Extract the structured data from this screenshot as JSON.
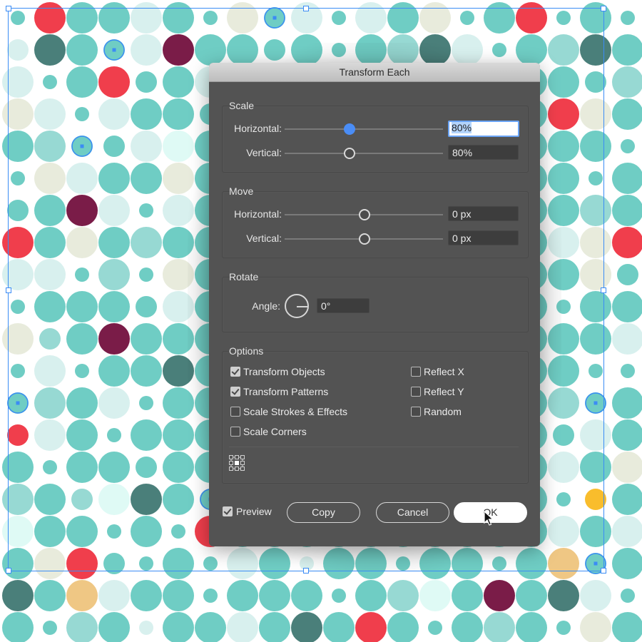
{
  "app": {
    "canvas_description": "polka-dot pattern artboard with selected objects"
  },
  "palette": {
    "T": "#6fcdc4",
    "L": "#d8f0ee",
    "B": "#e8ebdc",
    "R": "#f03e4c",
    "D": "#4a7f7a",
    "M": "#7a1c48",
    "P": "#97d9d3",
    "C": "#dffaf5",
    "Y": "#f9bd2c",
    "O": "#efc784",
    "selection": "#3b8cf5"
  },
  "pattern": {
    "rows": [
      "Ts Rl Tl Tl Ll Tl Ts Bl Tm* Ll Ts Ll Tl Bl Ts Tl Rl Ts Tl Ts",
      "Lm Dl Tl Tm* Ll Ml Tl Tl Tm Tl Ts Tl Pl Dl Ll Ts Tl Pl Dl Tl",
      "Ll Ts Tl Rl Tm Tl Ll Tl Tm Tl Ts Tl Tl Tl Tm Ll Tl Tl Tm Pl",
      "Bl Ll Ts Ll Tl Tl Tm Tl Tl Tl Tl Tl Tl Tl Tl Tl Tl Rl Bl Tl",
      "Tl Pl Tm* Tm Ll Cl Tl Tl Tl Tl Tl Tl Tl Tl Tl Tl Tl Tl Tl Ts",
      "Ts Bl Ll Tl Tl Bl Tl Tl Tl Tl Tl Tl Tl Tl Tl Tl Tl Tl Ts Tl",
      "Tm Tl Ml Ll Ts Ll Tl Tl Tl Tl Tl Tl Tl Tl Tl Tl Tl Tl Pl Tl",
      "Rl Tl Bl Tl Pl Tl Tl Tl Tl Tl Tl Tl Tl Tl Tl Tl Tl Ll Bl Rl",
      "Ll Ll Ts Pl Ts Bl Tl Tl Tl Tl Tl Tl Tl Tl Tl Tl Tl Tl Bl Tm",
      "Ts Tl Tl Tl Tm Ll Tl Tl Tl Tl Tl Tl Tl Tl Tl Tl Tl Ts Tl Tl",
      "Bl Pm Tl Ml Tl Tl Tl Tl Tl Tl Tl Tl Tl Tl Tl Tl Tl Tl Tl Ll",
      "Ts Ll Ts Tl Tl Dl Tl Tl Tl Tl Tl Tl Tl Tl Tl Tl Tl Tl Ts Ts",
      "Tm* Pl Tl Ll Ts Tl Tl Tl Tl Tl Tl Tl Tl Tl Tl Tl Tl Pl Tm* Tl",
      "Rm Ll Tl Ts Tl Tl Tl Tl Tl Tl Tl Tl Tl Tl Tl Tl Tl Tm Ll Tl",
      "Tl Ts Tl Tl Tm Tl Tl Tl Tl Tl Tl Tl Tl Tl Tl Tl Tl Ll Tl Bl",
      "Pl Tl Pm Cl Dl Tl Tm* Tl Tl Tl Tl Tl Tl Tl Tl Tl Tl Ts Ym Tl",
      "Cl Tl Tl Ts Tl Ts Rl Tl Tl Tl Tl Tl Tl Tl Tl Tl Tl Ll Tl Ll",
      "Tl Bl Rl Tm Ts Tl Ts Ll Tl Ls Tl Tl Ts Tl Tl Ts Tl Ol Tm* Tl",
      "Dl Tl Ol Ll Tl Tl Ts Tl Tl Tl Ts Tl Pl Cl Tl Ml Tl Dl Ll Ts",
      "Tl Ts Pl Tl Ls Tl Tl Ll Tl Dl Tl Rl Tl Ts Tl Pl Tl Ts Bl Tl"
    ]
  },
  "dialog": {
    "title": "Transform Each",
    "scale": {
      "label": "Scale",
      "horizontal": {
        "label": "Horizontal:",
        "value": "80%",
        "slider_fraction": 0.4
      },
      "vertical": {
        "label": "Vertical:",
        "value": "80%",
        "slider_fraction": 0.4
      }
    },
    "move": {
      "label": "Move",
      "horizontal": {
        "label": "Horizontal:",
        "value": "0 px",
        "slider_fraction": 0.5
      },
      "vertical": {
        "label": "Vertical:",
        "value": "0 px",
        "slider_fraction": 0.5
      }
    },
    "rotate": {
      "label": "Rotate",
      "angle_label": "Angle:",
      "angle_value": "0°"
    },
    "options": {
      "label": "Options",
      "transform_objects": {
        "label": "Transform Objects",
        "checked": true
      },
      "transform_patterns": {
        "label": "Transform Patterns",
        "checked": true
      },
      "scale_strokes": {
        "label": "Scale Strokes & Effects",
        "checked": false
      },
      "scale_corners": {
        "label": "Scale Corners",
        "checked": false
      },
      "reflect_x": {
        "label": "Reflect X",
        "checked": false
      },
      "reflect_y": {
        "label": "Reflect Y",
        "checked": false
      },
      "random": {
        "label": "Random",
        "checked": false
      },
      "reference_point": "center"
    },
    "footer": {
      "preview": {
        "label": "Preview",
        "checked": true
      },
      "copy_label": "Copy",
      "cancel_label": "Cancel",
      "ok_label": "OK"
    }
  }
}
